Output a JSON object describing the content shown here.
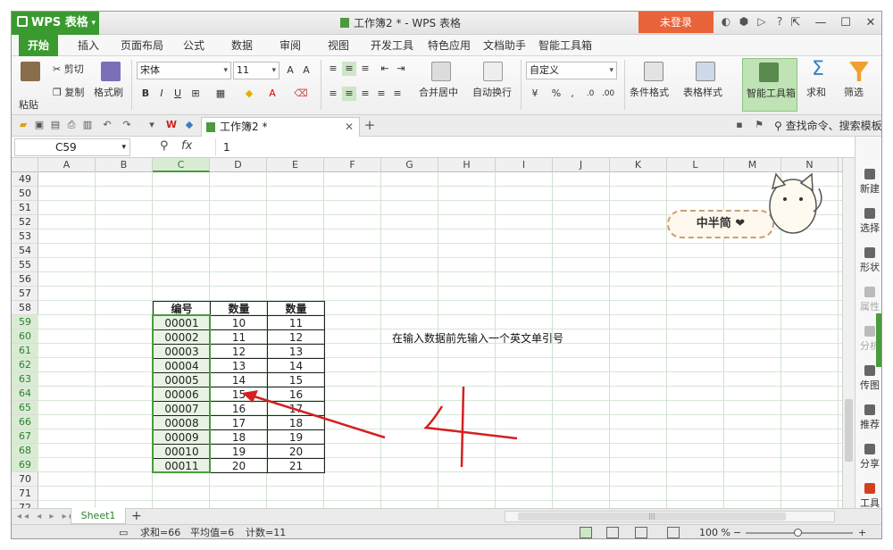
{
  "window": {
    "app_name": "WPS 表格",
    "title": "工作簿2 * - WPS 表格",
    "login_label": "未登录",
    "accent": "#3a9a2f",
    "login_color": "#e9633a"
  },
  "menu": [
    "开始",
    "插入",
    "页面布局",
    "公式",
    "数据",
    "审阅",
    "视图",
    "开发工具",
    "特色应用",
    "文档助手",
    "智能工具箱"
  ],
  "ribbon": {
    "paste": "粘贴",
    "cut": "剪切",
    "copy": "复制",
    "format_painter": "格式刷",
    "font_name": "宋体",
    "font_size": "11",
    "merge_center": "合并居中",
    "wrap_text": "自动换行",
    "number_format": "自定义",
    "conditional_format": "条件格式",
    "table_style": "表格样式",
    "smart_toolbox": "智能工具箱",
    "sum": "求和",
    "filter": "筛选"
  },
  "doc_tab": {
    "name": "工作簿2 *",
    "search": "查找命令、搜索模板"
  },
  "formula_bar": {
    "cell_ref": "C59",
    "fx": "fx",
    "value": "1"
  },
  "columns": [
    "A",
    "B",
    "C",
    "D",
    "E",
    "F",
    "G",
    "H",
    "I",
    "J",
    "K",
    "L",
    "M",
    "N"
  ],
  "rows": [
    "49",
    "50",
    "51",
    "52",
    "53",
    "54",
    "55",
    "56",
    "57",
    "58",
    "59",
    "60",
    "61",
    "62",
    "63",
    "64",
    "65",
    "66",
    "67",
    "68",
    "69",
    "70",
    "71",
    "72"
  ],
  "table": {
    "headers": [
      "编号",
      "数量",
      "数量"
    ],
    "rows": [
      [
        "00001",
        "10",
        "11"
      ],
      [
        "00002",
        "11",
        "12"
      ],
      [
        "00003",
        "12",
        "13"
      ],
      [
        "00004",
        "13",
        "14"
      ],
      [
        "00005",
        "14",
        "15"
      ],
      [
        "00006",
        "15",
        "16"
      ],
      [
        "00007",
        "16",
        "17"
      ],
      [
        "00008",
        "17",
        "18"
      ],
      [
        "00009",
        "18",
        "19"
      ],
      [
        "00010",
        "19",
        "20"
      ],
      [
        "00011",
        "20",
        "21"
      ]
    ]
  },
  "note": "在输入数据前先输入一个英文单引号",
  "sticker": "中半简 ❤",
  "right_panel": [
    "新建",
    "选择",
    "形状",
    "属性",
    "分析",
    "传图",
    "推荐",
    "分享",
    "工具"
  ],
  "sheet": {
    "name": "Sheet1",
    "add": "+"
  },
  "status": {
    "sum": "求和=66",
    "avg": "平均值=6",
    "count": "计数=11",
    "zoom": "100 %"
  }
}
